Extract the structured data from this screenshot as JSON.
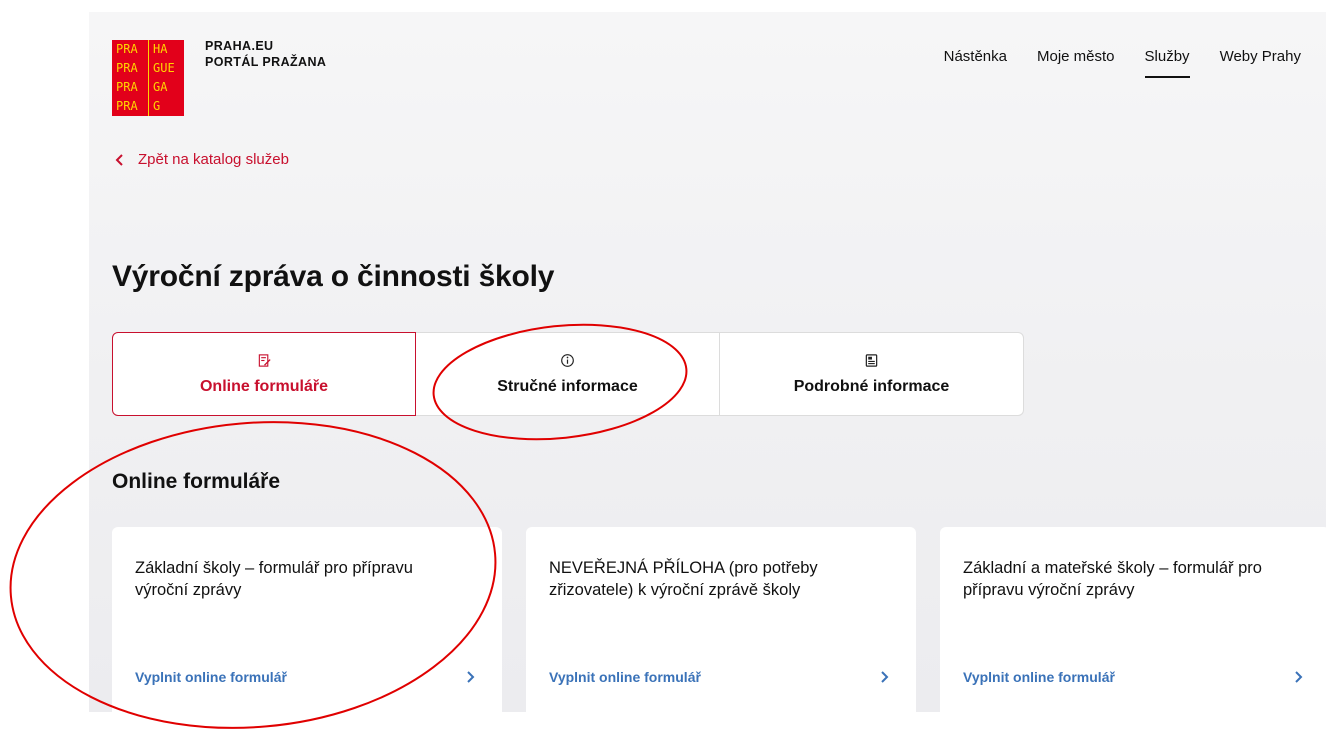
{
  "header": {
    "logo_lines": [
      "PRA",
      "HA",
      "PRA",
      "GUE",
      "PRA",
      "GA",
      "PRA",
      "G"
    ],
    "brand_line1": "PRAHA.EU",
    "brand_line2": "PORTÁL PRAŽANA",
    "nav": [
      {
        "label": "Nástěnka",
        "active": false
      },
      {
        "label": "Moje město",
        "active": false
      },
      {
        "label": "Služby",
        "active": true
      },
      {
        "label": "Weby Prahy",
        "active": false
      }
    ]
  },
  "back_link": {
    "label": "Zpět na katalog služeb",
    "icon": "chevron-left-icon"
  },
  "page_title": "Výroční zpráva o činnosti školy",
  "tabs": [
    {
      "label": "Online formuláře",
      "icon": "form-edit-icon",
      "active": true
    },
    {
      "label": "Stručné informace",
      "icon": "info-icon",
      "active": false
    },
    {
      "label": "Podrobné informace",
      "icon": "document-icon",
      "active": false
    }
  ],
  "section": {
    "title": "Online formuláře",
    "cards": [
      {
        "title": "Základní školy – formulář pro přípravu výroční zprávy",
        "link": "Vyplnit online formulář",
        "icon": "chevron-right-icon"
      },
      {
        "title": "NEVEŘEJNÁ PŘÍLOHA (pro potřeby zřizovatele) k výroční zprávě školy",
        "link": "Vyplnit online formulář",
        "icon": "chevron-right-icon"
      },
      {
        "title": "Základní a mateřské školy – formulář pro přípravu výroční zprávy",
        "link": "Vyplnit online formulář",
        "icon": "chevron-right-icon"
      }
    ]
  },
  "colors": {
    "brand_red": "#e2001a",
    "logo_yellow": "#ffd400",
    "accent_red": "#c8102e",
    "link_blue": "#3a72b8",
    "annotation_red": "#e00000"
  }
}
